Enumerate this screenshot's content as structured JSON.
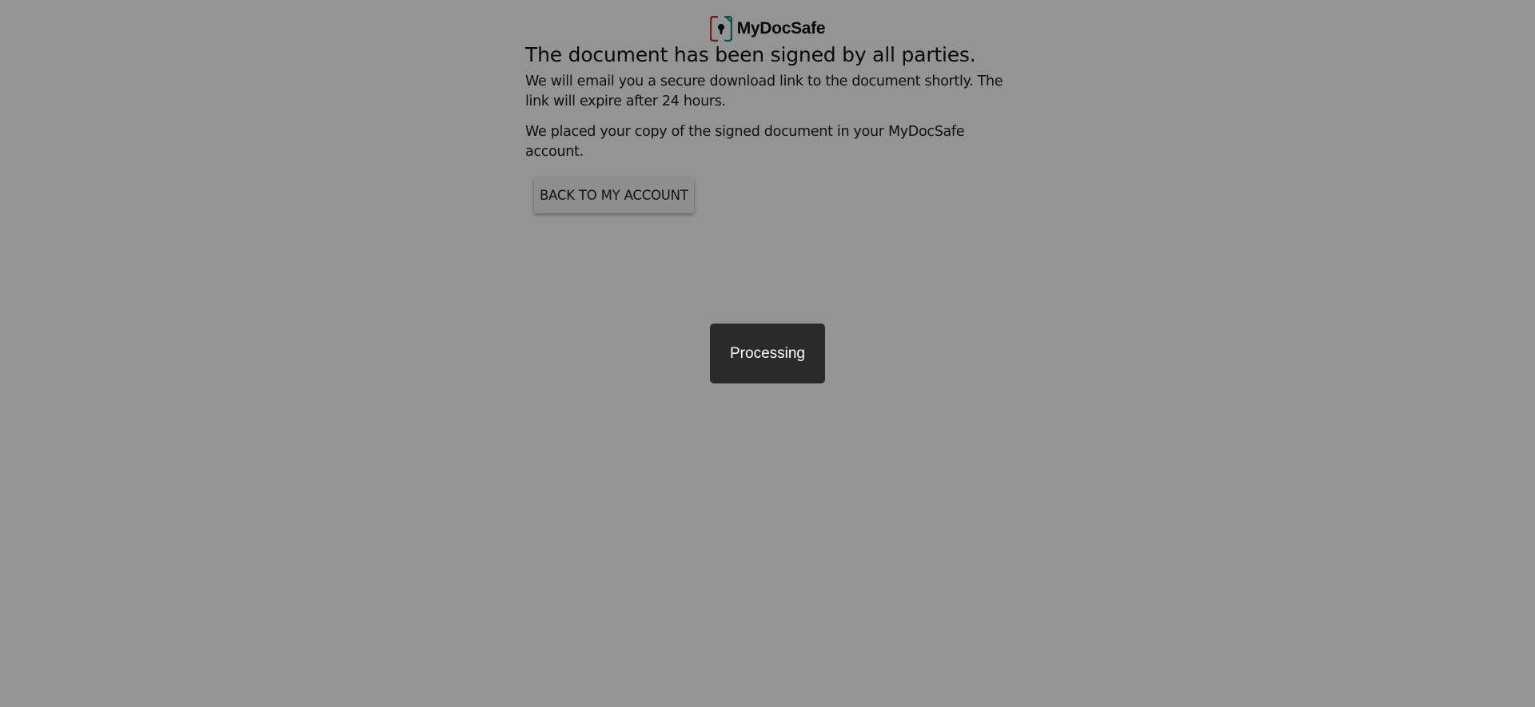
{
  "app": {
    "brand": "MyDocSafe"
  },
  "main": {
    "title": "The document has been signed by all parties.",
    "email_notice": "We will email you a secure download link to the document shortly. The link will expire after 24 hours.",
    "copy_notice": "We placed your copy of the signed document in your MyDocSafe account.",
    "back_button_label": "BACK TO MY ACCOUNT"
  },
  "overlay": {
    "status_text": "Processing",
    "backdrop_color": "#000000"
  },
  "colors": {
    "logo_left": "#c0392b",
    "logo_right": "#1a8a7a",
    "logo_lock": "#111111",
    "processing_bg": "#2a2a2a"
  },
  "icons": {
    "logo": "document-lock-icon"
  }
}
